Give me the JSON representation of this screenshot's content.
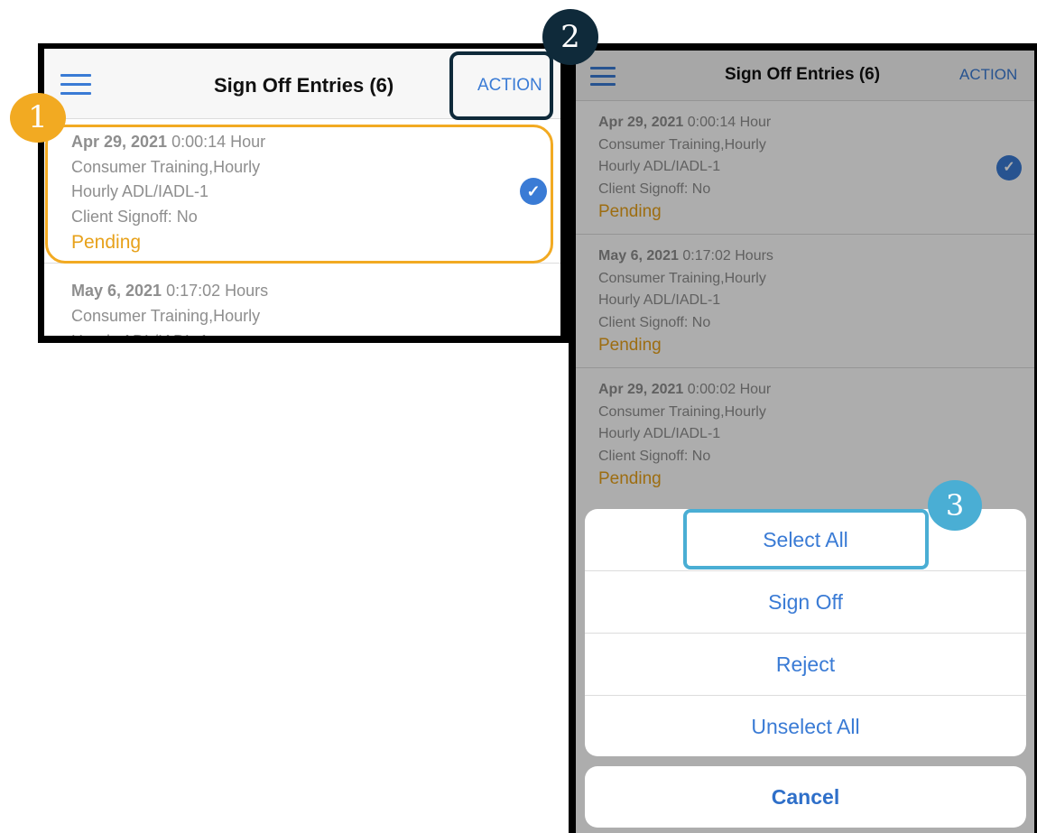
{
  "colors": {
    "accent": "#3a7bd5",
    "pending": "#e7a11a",
    "badge1": "#f2aa22",
    "badge2": "#0f2a3a",
    "badge3": "#4aaed4"
  },
  "header": {
    "menu_icon": "hamburger-icon",
    "title": "Sign Off Entries (6)",
    "action_label": "ACTION"
  },
  "entries": [
    {
      "date": "Apr 29, 2021",
      "duration": "0:00:14 Hour",
      "service": "Consumer Training,Hourly",
      "code": "Hourly ADL/IADL-1",
      "signoff": "Client Signoff: No",
      "status": "Pending",
      "selected": true
    },
    {
      "date": "May 6, 2021",
      "duration": "0:17:02 Hours",
      "service": "Consumer Training,Hourly",
      "code": "Hourly ADL/IADL-1",
      "signoff": "Client Signoff: No",
      "status": "Pending",
      "selected": false
    },
    {
      "date": "Apr 29, 2021",
      "duration": "0:00:02 Hour",
      "service": "Consumer Training,Hourly",
      "code": "Hourly ADL/IADL-1",
      "signoff": "Client Signoff: No",
      "status": "Pending",
      "selected": false
    }
  ],
  "action_sheet": {
    "items": [
      "Select All",
      "Sign Off",
      "Reject",
      "Unselect All"
    ],
    "cancel": "Cancel"
  },
  "badges": [
    "1",
    "2",
    "3"
  ]
}
